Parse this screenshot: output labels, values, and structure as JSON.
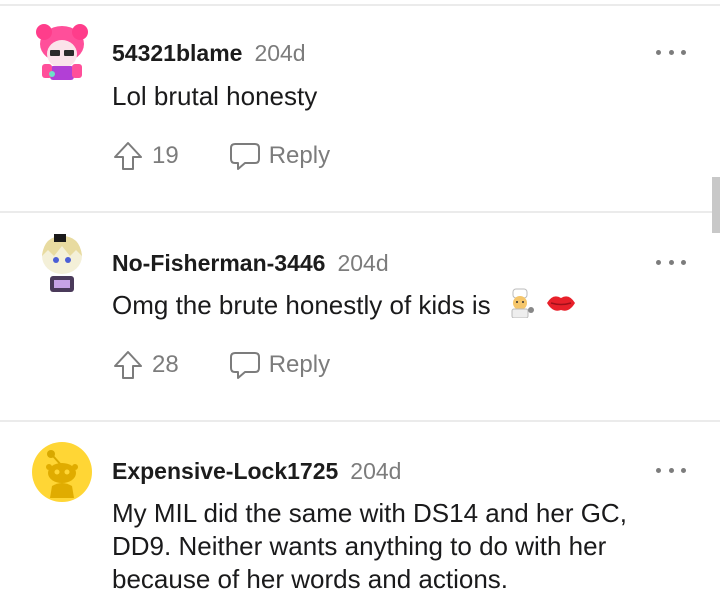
{
  "comments": [
    {
      "username": "54321blame",
      "age": "204d",
      "text": "Lol brutal honesty",
      "votes": "19",
      "reply_label": "Reply",
      "avatar_icon": "pink-anime-avatar-icon"
    },
    {
      "username": "No-Fisherman-3446",
      "age": "204d",
      "text": "Omg the brute honestly of kids is",
      "emojis": [
        "woman-cook-emoji",
        "kiss-mark-emoji"
      ],
      "votes": "28",
      "reply_label": "Reply",
      "avatar_icon": "blonde-avatar-icon"
    },
    {
      "username": "Expensive-Lock1725",
      "age": "204d",
      "text_lines": [
        "My MIL did the same with DS14 and her GC,",
        "DD9. Neither wants anything to do with her",
        "because of her words and actions."
      ],
      "avatar_icon": "default-snoo-avatar-icon",
      "avatar_color": "#ffd635"
    }
  ],
  "colors": {
    "meta_gray": "#7c7c7c",
    "divider": "#ebebeb",
    "text": "#1a1a1b"
  }
}
